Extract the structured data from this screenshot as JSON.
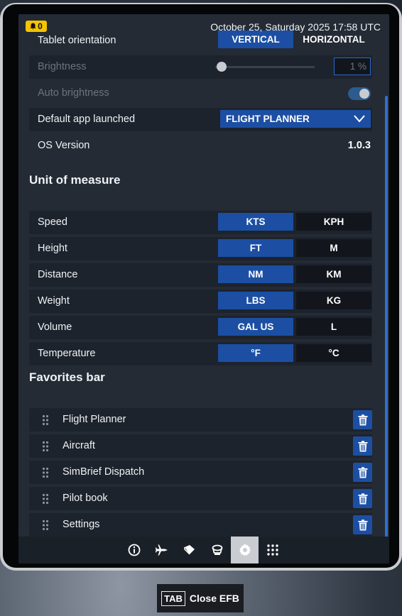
{
  "status_bar": {
    "notification_count": "0",
    "datetime": "October 25, Saturday 2025 17:58 UTC"
  },
  "settings": {
    "tablet_orientation": {
      "label": "Tablet orientation",
      "options": [
        "VERTICAL",
        "HORIZONTAL"
      ],
      "selected": "VERTICAL"
    },
    "brightness": {
      "label": "Brightness",
      "value": "1 %",
      "level_fraction": 0.01
    },
    "auto_brightness": {
      "label": "Auto brightness",
      "enabled": true
    },
    "default_app": {
      "label": "Default app launched",
      "value": "FLIGHT PLANNER"
    },
    "os_version": {
      "label": "OS Version",
      "value": "1.0.3"
    }
  },
  "units": {
    "title": "Unit of measure",
    "rows": [
      {
        "label": "Speed",
        "options": [
          "KTS",
          "KPH"
        ],
        "selected": 0
      },
      {
        "label": "Height",
        "options": [
          "FT",
          "M"
        ],
        "selected": 0
      },
      {
        "label": "Distance",
        "options": [
          "NM",
          "KM"
        ],
        "selected": 0
      },
      {
        "label": "Weight",
        "options": [
          "LBS",
          "KG"
        ],
        "selected": 0
      },
      {
        "label": "Volume",
        "options": [
          "GAL US",
          "L"
        ],
        "selected": 0
      },
      {
        "label": "Temperature",
        "options": [
          "°F",
          "°C"
        ],
        "selected": 0
      }
    ]
  },
  "favorites": {
    "title": "Favorites bar",
    "items": [
      "Flight Planner",
      "Aircraft",
      "SimBrief Dispatch",
      "Pilot book",
      "Settings"
    ]
  },
  "bottom_nav": [
    {
      "icon": "info-icon"
    },
    {
      "icon": "airplane-icon"
    },
    {
      "icon": "book-icon"
    },
    {
      "icon": "pilot-cap-icon"
    },
    {
      "icon": "gear-icon",
      "active": true
    },
    {
      "icon": "apps-grid-icon"
    }
  ],
  "footer": {
    "key": "TAB",
    "label": "Close EFB"
  },
  "colors": {
    "accent": "#1c4fa3",
    "background": "#242b35",
    "row": "#1d232c",
    "notification": "#f4c400"
  }
}
